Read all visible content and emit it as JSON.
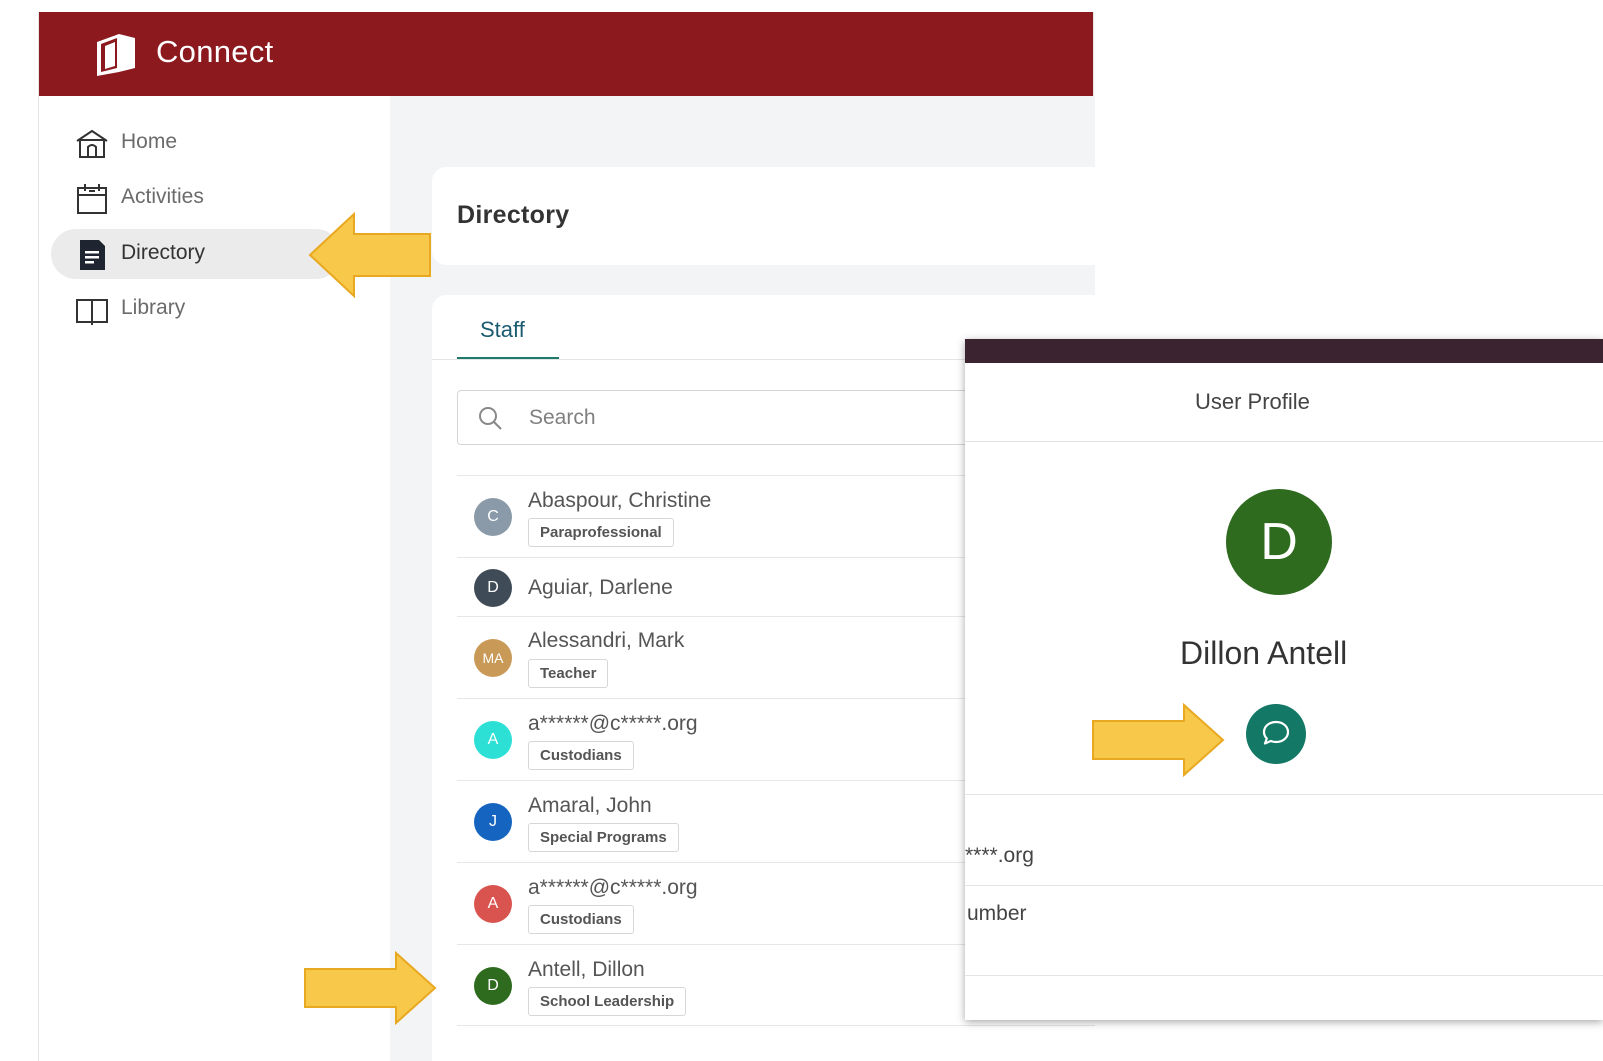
{
  "app": {
    "title": "Connect",
    "brand_color": "#8b191e"
  },
  "sidebar": {
    "items": [
      {
        "label": "Home",
        "icon": "home-icon"
      },
      {
        "label": "Activities",
        "icon": "calendar-icon"
      },
      {
        "label": "Directory",
        "icon": "document-icon",
        "active": true
      },
      {
        "label": "Library",
        "icon": "book-icon"
      }
    ]
  },
  "main": {
    "page_title": "Directory",
    "tabs": [
      {
        "label": "Staff",
        "active": true
      }
    ],
    "search": {
      "placeholder": "Search"
    },
    "rows": [
      {
        "initials": "C",
        "avatar_color": "#8a9aa8",
        "name": "Abaspour, Christine",
        "tag": "Paraprofessional"
      },
      {
        "initials": "D",
        "avatar_color": "#3f4c57",
        "name": "Aguiar, Darlene",
        "tag": ""
      },
      {
        "initials": "MA",
        "avatar_color": "#c99a57",
        "name": "Alessandri, Mark",
        "tag": "Teacher"
      },
      {
        "initials": "A",
        "avatar_color": "#2de0d6",
        "name": "a******@c*****.org",
        "tag": "Custodians"
      },
      {
        "initials": "J",
        "avatar_color": "#1565c0",
        "name": "Amaral, John",
        "tag": "Special Programs"
      },
      {
        "initials": "A",
        "avatar_color": "#d9534f",
        "name": "a******@c*****.org",
        "tag": "Custodians"
      },
      {
        "initials": "D",
        "avatar_color": "#2e6b1f",
        "name": "Antell, Dillon",
        "tag": "School Leadership"
      }
    ]
  },
  "profile": {
    "title": "User Profile",
    "initial": "D",
    "avatar_color": "#2e6b1f",
    "name": "Dillon Antell",
    "email_fragment": "****.org",
    "phone_fragment": "umber",
    "chat_color": "#137865"
  },
  "annotations": {
    "arrow_color": "#f8c84a"
  }
}
